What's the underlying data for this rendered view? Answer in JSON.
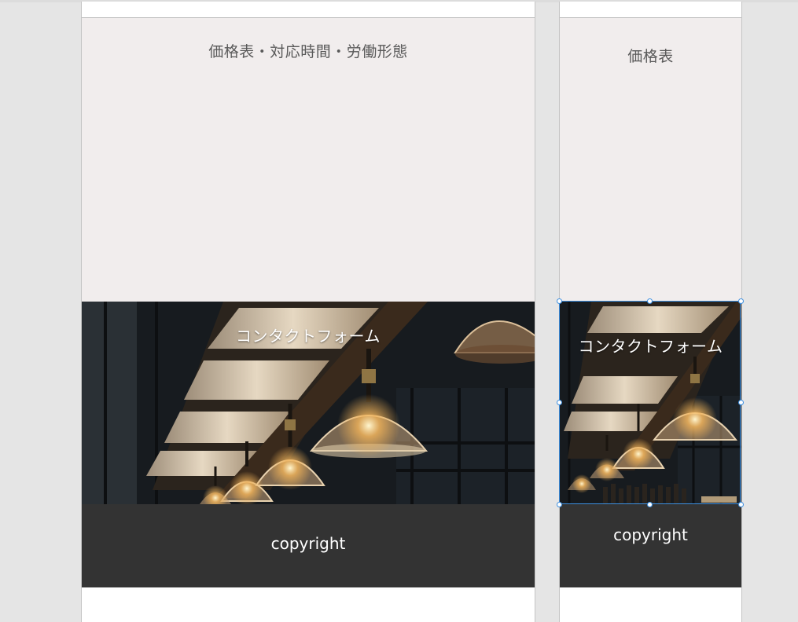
{
  "artboards": [
    {
      "id": "desktop",
      "price_title": "価格表・対応時間・労働形態",
      "contact_title": "コンタクトフォーム",
      "footer_text": "copyright"
    },
    {
      "id": "mobile",
      "price_title": "価格表",
      "contact_title": "コンタクトフォーム",
      "footer_text": "copyright"
    }
  ],
  "contact_image": "pendant-lamps-photo",
  "colors": {
    "canvas": "#e5e5e5",
    "artboard": "#ffffff",
    "price_bg": "#f1eded",
    "price_text": "#595959",
    "footer_bg": "#333333",
    "footer_text": "#ffffff",
    "selection": "#3d8fe0"
  }
}
